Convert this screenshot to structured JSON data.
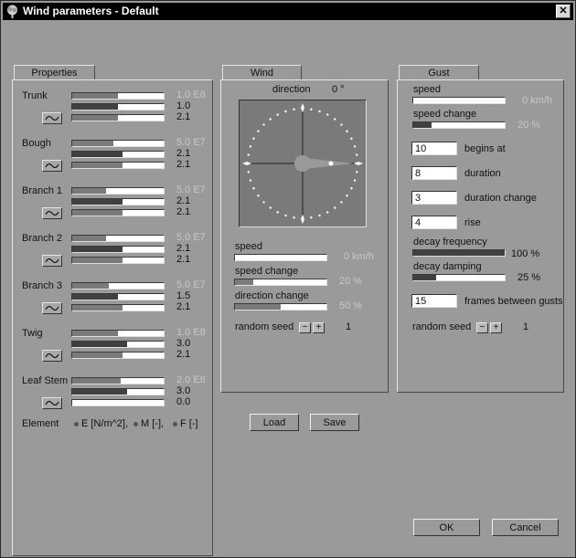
{
  "window": {
    "title": "Wind parameters - Default",
    "close": "✕"
  },
  "properties": {
    "tab": "Properties",
    "rows": [
      {
        "name": "Trunk",
        "values": [
          "1.0 E8",
          "1.0",
          "2.1"
        ],
        "fills": [
          0.5,
          0.5,
          0.5
        ]
      },
      {
        "name": "Bough",
        "values": [
          "5.0 E7",
          "2.1",
          "2.1"
        ],
        "fills": [
          0.45,
          0.55,
          0.55
        ]
      },
      {
        "name": "Branch 1",
        "values": [
          "5.0 E7",
          "2.1",
          "2.1"
        ],
        "fills": [
          0.37,
          0.55,
          0.55
        ]
      },
      {
        "name": "Branch 2",
        "values": [
          "5.0 E7",
          "2.1",
          "2.1"
        ],
        "fills": [
          0.37,
          0.55,
          0.55
        ]
      },
      {
        "name": "Branch 3",
        "values": [
          "5.0 E7",
          "1.5",
          "2.1"
        ],
        "fills": [
          0.4,
          0.5,
          0.55
        ]
      },
      {
        "name": "Twig",
        "values": [
          "1.0 E8",
          "3.0",
          "2.1"
        ],
        "fills": [
          0.5,
          0.6,
          0.55
        ]
      },
      {
        "name": "Leaf Stem",
        "values": [
          "2.0 E8",
          "3.0",
          "0.0"
        ],
        "fills": [
          0.53,
          0.6,
          0.0
        ]
      }
    ],
    "legend": {
      "label": "Element",
      "e": "E [N/m^2],",
      "m": "M [-],",
      "f": "F [-]"
    }
  },
  "wind": {
    "tab": "Wind",
    "direction_label": "direction",
    "direction_value": "0 °",
    "speed_label": "speed",
    "speed_value": "0 km/h",
    "speed_fill": 0.0,
    "speed_change_label": "speed change",
    "speed_change_value": "20 %",
    "speed_change_fill": 0.2,
    "direction_change_label": "direction change",
    "direction_change_value": "50 %",
    "direction_change_fill": 0.5,
    "random_seed_label": "random seed",
    "random_seed_value": "1",
    "minus": "−",
    "plus": "+"
  },
  "gust": {
    "tab": "Gust",
    "speed_label": "speed",
    "speed_value": "0 km/h",
    "speed_fill": 0.0,
    "speed_change_label": "speed change",
    "speed_change_value": "20 %",
    "speed_change_fill": 0.2,
    "begins_at_value": "10",
    "begins_at_label": "begins at",
    "duration_value": "8",
    "duration_label": "duration",
    "duration_change_value": "3",
    "duration_change_label": "duration change",
    "rise_value": "4",
    "rise_label": "rise",
    "decay_frequency_label": "decay frequency",
    "decay_frequency_value": "100 %",
    "decay_frequency_fill": 1.0,
    "decay_damping_label": "decay damping",
    "decay_damping_value": "25 %",
    "decay_damping_fill": 0.25,
    "frames_value": "15",
    "frames_label": "frames between gusts",
    "random_seed_label": "random seed",
    "random_seed_value": "1",
    "minus": "−",
    "plus": "+"
  },
  "buttons": {
    "load": "Load",
    "save": "Save",
    "ok": "OK",
    "cancel": "Cancel"
  }
}
